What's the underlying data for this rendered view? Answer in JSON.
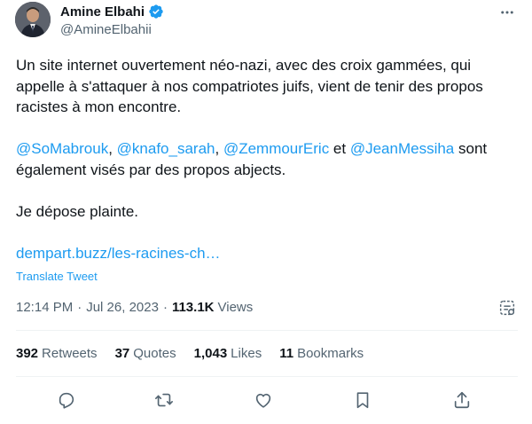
{
  "author": {
    "name": "Amine Elbahi",
    "handle": "@AmineElbahii",
    "verified": true
  },
  "tweet": {
    "paragraph1": "Un site internet ouvertement néo-nazi, avec des croix gammées, qui appelle à s'attaquer à nos compatriotes juifs, vient de tenir des propos racistes à mon encontre.",
    "mentions": [
      "@SoMabrouk",
      "@knafo_sarah",
      "@ZemmourEric",
      "@JeanMessiha"
    ],
    "sep1": ", ",
    "sep2": ", ",
    "sep3": " et ",
    "paragraph2_suffix": " sont également visés par des propos abjects.",
    "paragraph3": "Je dépose plainte.",
    "link": "dempart.buzz/les-racines-ch…",
    "translate": "Translate Tweet"
  },
  "meta": {
    "time": "12:14 PM",
    "separator1": "·",
    "date": "Jul 26, 2023",
    "separator2": "·",
    "views_count": "113.1K",
    "views_label": "Views"
  },
  "stats": [
    {
      "count": "392",
      "label": "Retweets"
    },
    {
      "count": "37",
      "label": "Quotes"
    },
    {
      "count": "1,043",
      "label": "Likes"
    },
    {
      "count": "11",
      "label": "Bookmarks"
    }
  ],
  "actions": [
    {
      "icon": "reply-icon"
    },
    {
      "icon": "retweet-icon"
    },
    {
      "icon": "like-icon"
    },
    {
      "icon": "bookmark-icon"
    },
    {
      "icon": "share-icon"
    }
  ],
  "colors": {
    "accent": "#1d9bf0",
    "text": "#0f1419",
    "secondary": "#536471",
    "divider": "#eff3f4"
  }
}
